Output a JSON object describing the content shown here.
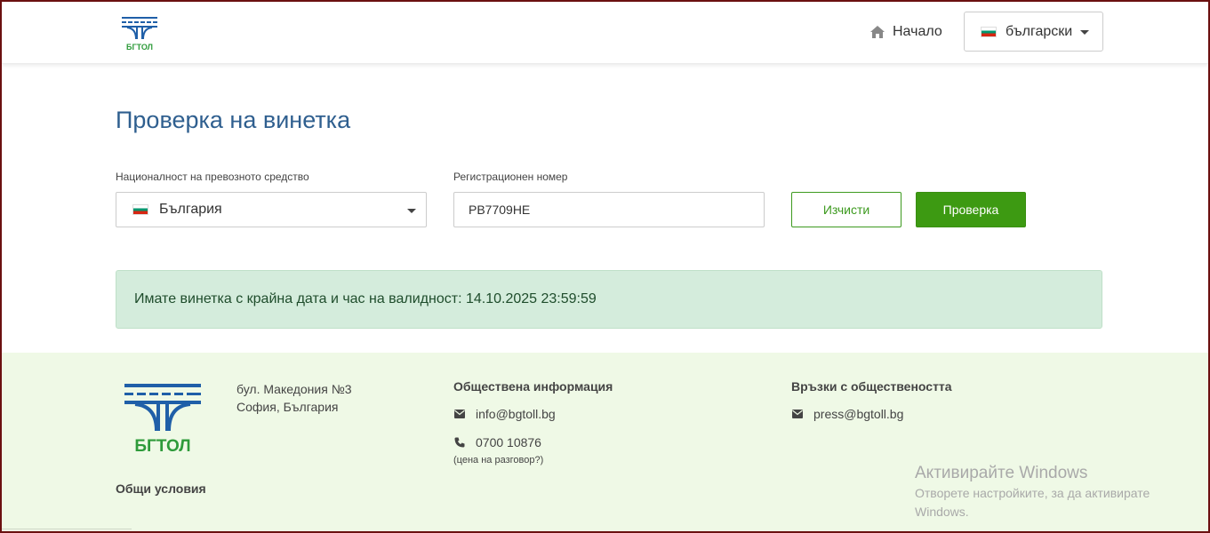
{
  "header": {
    "logo_text": "БГТОЛ",
    "home_label": "Начало",
    "language": {
      "selected": "български",
      "flag": "bulgaria-flag"
    }
  },
  "main": {
    "title": "Проверка на винетка",
    "nationality": {
      "label": "Националност на превозното средство",
      "selected": "България",
      "flag": "bulgaria-flag"
    },
    "registration": {
      "label": "Регистрационен номер",
      "value": "PB7709HE"
    },
    "clear_label": "Изчисти",
    "check_label": "Проверка",
    "alert_text": "Имате винетка с крайна дата и час на валидност: 14.10.2025 23:59:59"
  },
  "footer": {
    "logo_text": "БГТОЛ",
    "address": [
      "бул. Македония №3",
      "София, България"
    ],
    "public_info": {
      "heading": "Обществена информация",
      "email": "info@bgtoll.bg",
      "phone": "0700 10876",
      "phone_note": "(цена на разговор?)"
    },
    "pr": {
      "heading": "Връзки с обществеността",
      "email": "press@bgtoll.bg"
    },
    "terms": "Общи условия"
  },
  "watermark": {
    "title": "Активирайте Windows",
    "subtitle": "Отворете настройките, за да активирате Windows."
  },
  "colors": {
    "title_blue": "#2f5f8f",
    "green": "#3d9a12",
    "alert_bg": "#d4ecdc",
    "footer_bg": "#eff9e6",
    "logo_blue": "#1f5fa8",
    "logo_green": "#2e9b3a"
  }
}
